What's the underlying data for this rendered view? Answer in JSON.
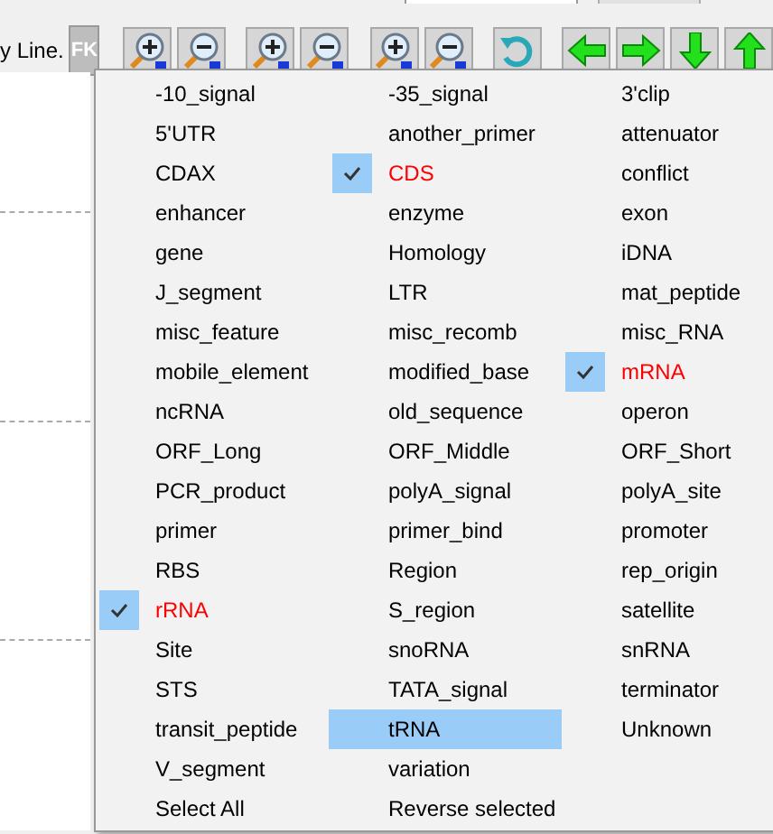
{
  "toolbar": {
    "line_label": "y Line.",
    "feature_button": "FK"
  },
  "feature_menu": {
    "columns": [
      [
        {
          "label": "-10_signal",
          "checked": false,
          "selected": false
        },
        {
          "label": "5'UTR",
          "checked": false,
          "selected": false
        },
        {
          "label": "CDAX",
          "checked": false,
          "selected": false
        },
        {
          "label": "enhancer",
          "checked": false,
          "selected": false
        },
        {
          "label": "gene",
          "checked": false,
          "selected": false
        },
        {
          "label": "J_segment",
          "checked": false,
          "selected": false
        },
        {
          "label": "misc_feature",
          "checked": false,
          "selected": false
        },
        {
          "label": "mobile_element",
          "checked": false,
          "selected": false
        },
        {
          "label": "ncRNA",
          "checked": false,
          "selected": false
        },
        {
          "label": "ORF_Long",
          "checked": false,
          "selected": false
        },
        {
          "label": "PCR_product",
          "checked": false,
          "selected": false
        },
        {
          "label": "primer",
          "checked": false,
          "selected": false
        },
        {
          "label": "RBS",
          "checked": false,
          "selected": false
        },
        {
          "label": "rRNA",
          "checked": true,
          "selected": false
        },
        {
          "label": "Site",
          "checked": false,
          "selected": false
        },
        {
          "label": "STS",
          "checked": false,
          "selected": false
        },
        {
          "label": "transit_peptide",
          "checked": false,
          "selected": false
        },
        {
          "label": "V_segment",
          "checked": false,
          "selected": false
        },
        {
          "label": "Select All",
          "checked": false,
          "selected": false
        }
      ],
      [
        {
          "label": "-35_signal",
          "checked": false,
          "selected": false
        },
        {
          "label": "another_primer",
          "checked": false,
          "selected": false
        },
        {
          "label": "CDS",
          "checked": true,
          "selected": false
        },
        {
          "label": "enzyme",
          "checked": false,
          "selected": false
        },
        {
          "label": "Homology",
          "checked": false,
          "selected": false
        },
        {
          "label": "LTR",
          "checked": false,
          "selected": false
        },
        {
          "label": "misc_recomb",
          "checked": false,
          "selected": false
        },
        {
          "label": "modified_base",
          "checked": false,
          "selected": false
        },
        {
          "label": "old_sequence",
          "checked": false,
          "selected": false
        },
        {
          "label": "ORF_Middle",
          "checked": false,
          "selected": false
        },
        {
          "label": "polyA_signal",
          "checked": false,
          "selected": false
        },
        {
          "label": "primer_bind",
          "checked": false,
          "selected": false
        },
        {
          "label": "Region",
          "checked": false,
          "selected": false
        },
        {
          "label": "S_region",
          "checked": false,
          "selected": false
        },
        {
          "label": "snoRNA",
          "checked": false,
          "selected": false
        },
        {
          "label": "TATA_signal",
          "checked": false,
          "selected": false
        },
        {
          "label": "tRNA",
          "checked": false,
          "selected": true
        },
        {
          "label": "variation",
          "checked": false,
          "selected": false
        },
        {
          "label": "Reverse selected",
          "checked": false,
          "selected": false
        }
      ],
      [
        {
          "label": "3'clip",
          "checked": false,
          "selected": false
        },
        {
          "label": "attenuator",
          "checked": false,
          "selected": false
        },
        {
          "label": "conflict",
          "checked": false,
          "selected": false
        },
        {
          "label": "exon",
          "checked": false,
          "selected": false
        },
        {
          "label": "iDNA",
          "checked": false,
          "selected": false
        },
        {
          "label": "mat_peptide",
          "checked": false,
          "selected": false
        },
        {
          "label": "misc_RNA",
          "checked": false,
          "selected": false
        },
        {
          "label": "mRNA",
          "checked": true,
          "selected": false
        },
        {
          "label": "operon",
          "checked": false,
          "selected": false
        },
        {
          "label": "ORF_Short",
          "checked": false,
          "selected": false
        },
        {
          "label": "polyA_site",
          "checked": false,
          "selected": false
        },
        {
          "label": "promoter",
          "checked": false,
          "selected": false
        },
        {
          "label": "rep_origin",
          "checked": false,
          "selected": false
        },
        {
          "label": "satellite",
          "checked": false,
          "selected": false
        },
        {
          "label": "snRNA",
          "checked": false,
          "selected": false
        },
        {
          "label": "terminator",
          "checked": false,
          "selected": false
        },
        {
          "label": "Unknown",
          "checked": false,
          "selected": false
        }
      ]
    ]
  }
}
